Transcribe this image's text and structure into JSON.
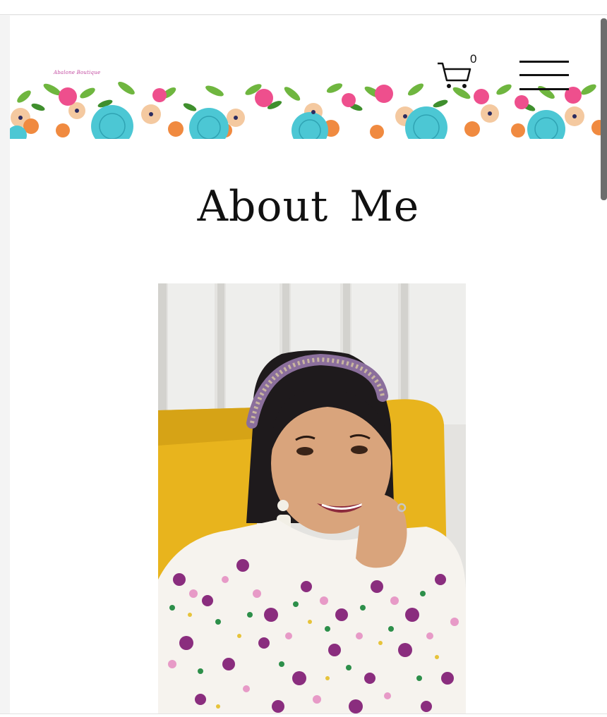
{
  "header": {
    "logo_text": "Abalone Boutique",
    "cart_count": "0",
    "cart_icon": "shopping-cart-icon",
    "menu_icon": "hamburger-menu-icon"
  },
  "main": {
    "title": "About Me",
    "photo_alt": "Smiling woman with a jeweled headband and floral dress sitting on a yellow chair"
  },
  "colors": {
    "background": "#ffffff",
    "text": "#111111",
    "chair_yellow": "#e8b41d",
    "flower_pink": "#ee4f8d",
    "flower_blue": "#4cc7d4",
    "flower_orange": "#f08a40"
  }
}
